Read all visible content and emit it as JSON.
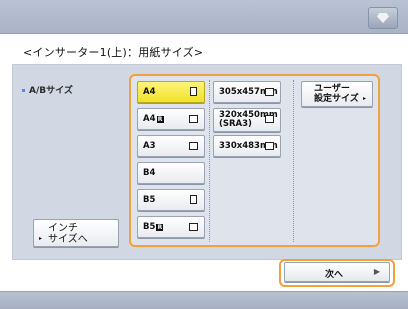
{
  "header": {
    "icon": "gem-icon"
  },
  "title": "<インサーター1(上)：用紙サイズ>",
  "group_label": "A/Bサイズ",
  "sizes": [
    {
      "label": "A4",
      "mark": "",
      "selected": true
    },
    {
      "label": "A4",
      "mark": "R",
      "selected": false
    },
    {
      "label": "A3",
      "mark": "",
      "selected": false
    },
    {
      "label": "B4",
      "mark": "",
      "selected": false
    },
    {
      "label": "B5",
      "mark": "",
      "selected": false
    },
    {
      "label": "B5",
      "mark": "R",
      "selected": false
    }
  ],
  "special_sizes": [
    {
      "label": "305x457mm"
    },
    {
      "label": "320x450mm\n(SRA3)"
    },
    {
      "label": "330x483mm"
    }
  ],
  "user_button": {
    "label": "ユーザー\n設定サイズ",
    "arrow": "▸"
  },
  "inch_button": {
    "label": "インチ\nサイズへ",
    "arrow": "▸"
  },
  "next_button": {
    "label": "次へ",
    "arrow": "▶"
  },
  "colors": {
    "selected": "#f5e63b",
    "highlight_frame": "#f0a03c",
    "panel": "#d2d8e3",
    "bar": "#b0bacb"
  }
}
